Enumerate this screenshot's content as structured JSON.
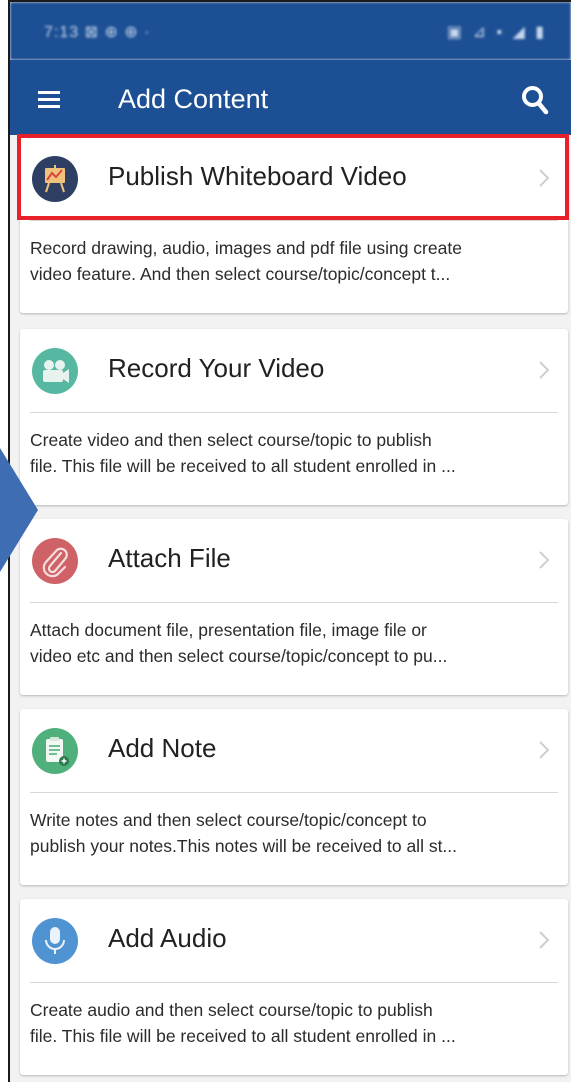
{
  "status_bar": {
    "time": "7:13 ⊠ ⊕ ⊕ ·",
    "indicators": "▣ ⊿ ▪ ◢ ▮"
  },
  "app_bar": {
    "title": "Add Content",
    "menu_icon": "hamburger-icon",
    "search_icon": "search-icon"
  },
  "colors": {
    "app_bar": "#1c4f93",
    "highlight": "#e8202a",
    "pointer_arrow": "#3f6db3",
    "whiteboard_icon": "#2e3f63",
    "video_icon": "#57b8a1",
    "attach_icon": "#cf6266",
    "note_icon": "#4fb07c",
    "audio_icon": "#4f93d2"
  },
  "cards": [
    {
      "title": "Publish Whiteboard Video",
      "icon": "whiteboard-easel-icon",
      "desc_line1": "Record drawing, audio, images and pdf file using create",
      "desc_line2": "video feature. And then select course/topic/concept t..."
    },
    {
      "title": "Record Your Video",
      "icon": "video-camera-icon",
      "desc_line1": "Create video and then select course/topic to publish",
      "desc_line2": "file. This file will be received to all student enrolled in ..."
    },
    {
      "title": "Attach File",
      "icon": "paperclip-icon",
      "desc_line1": "Attach document file, presentation file, image file or",
      "desc_line2": "video etc and then select course/topic/concept to pu..."
    },
    {
      "title": "Add Note",
      "icon": "note-icon",
      "desc_line1": "Write notes and then select course/topic/concept to",
      "desc_line2": "publish your notes.This notes will be received to all st..."
    },
    {
      "title": "Add Audio",
      "icon": "microphone-icon",
      "desc_line1": "Create audio and then select course/topic to publish",
      "desc_line2": "file. This file will be received to all student enrolled in ..."
    }
  ]
}
